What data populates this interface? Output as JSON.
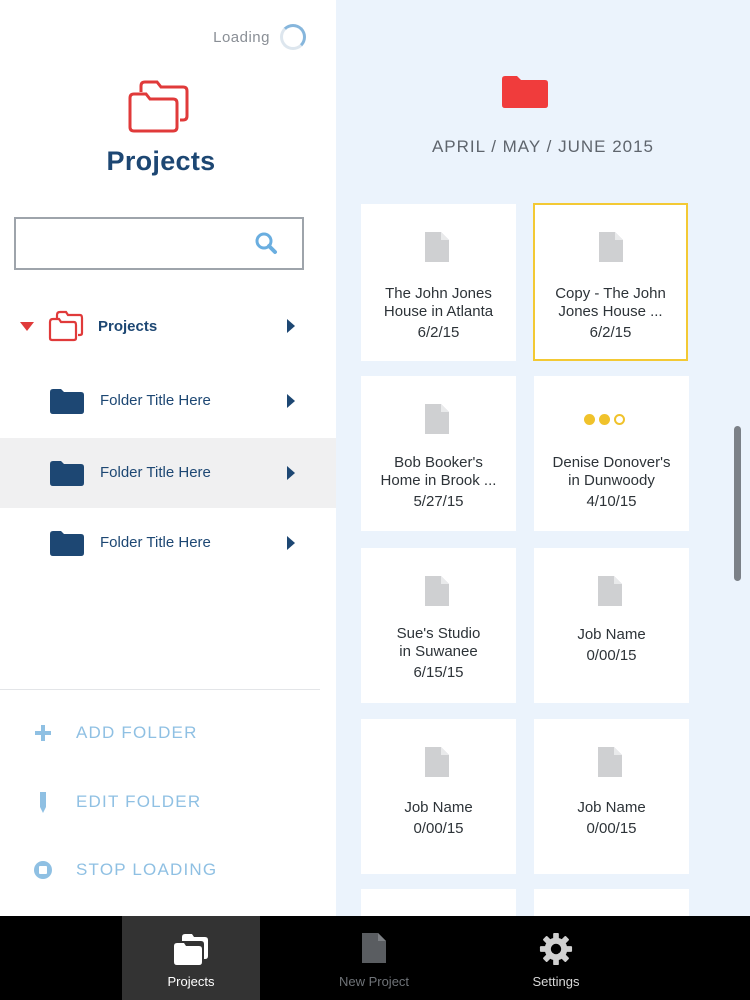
{
  "colors": {
    "brand_navy": "#1d4773",
    "accent_red": "#e03a3a",
    "action_blue": "#8fc0e3",
    "selected_border": "#f3c934",
    "progress_yellow": "#f0c22b",
    "main_bg": "#ebf3fc"
  },
  "sidebar": {
    "loading_label": "Loading",
    "title": "Projects",
    "search": {
      "value": "",
      "placeholder": ""
    },
    "tree": {
      "root": {
        "label": "Projects",
        "expanded": true
      },
      "folders": [
        {
          "label": "Folder Title Here",
          "selected": false
        },
        {
          "label": "Folder Title Here",
          "selected": true
        },
        {
          "label": "Folder Title Here",
          "selected": false
        }
      ]
    },
    "actions": [
      {
        "label": "ADD FOLDER",
        "icon": "plus-icon"
      },
      {
        "label": "EDIT FOLDER",
        "icon": "pencil-icon"
      },
      {
        "label": "STOP LOADING",
        "icon": "stop-icon"
      }
    ]
  },
  "main": {
    "date_title": "APRIL / MAY / JUNE 2015",
    "cards": [
      {
        "title_line1": "The John Jones",
        "title_line2": "House in Atlanta",
        "date": "6/2/15",
        "selected": false,
        "icon": "document-icon"
      },
      {
        "title_line1": "Copy - The John",
        "title_line2": "Jones House ...",
        "date": "6/2/15",
        "selected": true,
        "icon": "document-icon"
      },
      {
        "title_line1": "Bob Booker's",
        "title_line2": "Home in Brook ...",
        "date": "5/27/15",
        "selected": false,
        "icon": "document-icon"
      },
      {
        "title_line1": "Denise Donover's",
        "title_line2": "in Dunwoody",
        "date": "4/10/15",
        "selected": false,
        "icon": "loading-dots-icon"
      },
      {
        "title_line1": "Sue's Studio",
        "title_line2": "in Suwanee",
        "date": "6/15/15",
        "selected": false,
        "icon": "document-icon"
      },
      {
        "title_line1": "Job Name",
        "title_line2": "",
        "date": "0/00/15",
        "selected": false,
        "icon": "document-icon"
      },
      {
        "title_line1": "Job Name",
        "title_line2": "",
        "date": "0/00/15",
        "selected": false,
        "icon": "document-icon"
      },
      {
        "title_line1": "Job Name",
        "title_line2": "",
        "date": "0/00/15",
        "selected": false,
        "icon": "document-icon"
      }
    ]
  },
  "tabbar": {
    "tabs": [
      {
        "label": "Projects",
        "icon": "folders-icon",
        "active": true
      },
      {
        "label": "New Project",
        "icon": "document-icon",
        "active": false
      },
      {
        "label": "Settings",
        "icon": "gear-icon",
        "active": false
      }
    ]
  }
}
